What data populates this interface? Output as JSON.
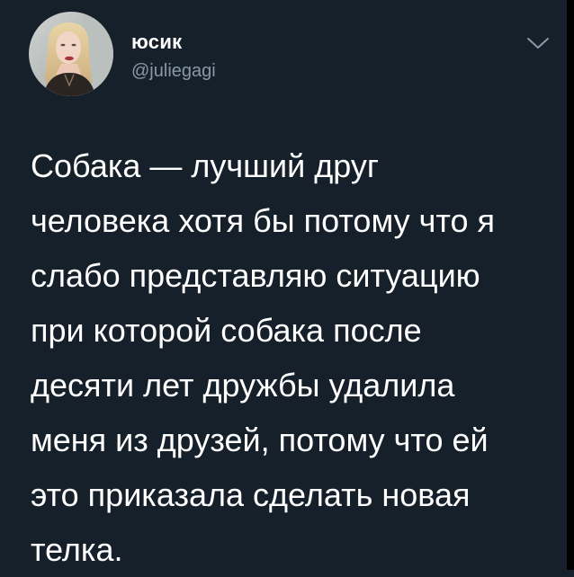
{
  "user": {
    "display_name": "юсик",
    "handle": "@juliegagi",
    "avatar_icon": "profile-photo"
  },
  "menu": {
    "icon": "chevron-down-icon"
  },
  "tweet": {
    "lines": [
      "Собака — лучший друг",
      "человека хотя бы потому что я",
      "слабо представляю ситуацию",
      "при которой собака после",
      "десяти лет дружбы удалила",
      "меня из друзей, потому что ей",
      "это приказала сделать новая",
      "телка."
    ]
  },
  "colors": {
    "background": "#15202b",
    "text_primary": "#ffffff",
    "text_secondary": "#8899a6"
  }
}
